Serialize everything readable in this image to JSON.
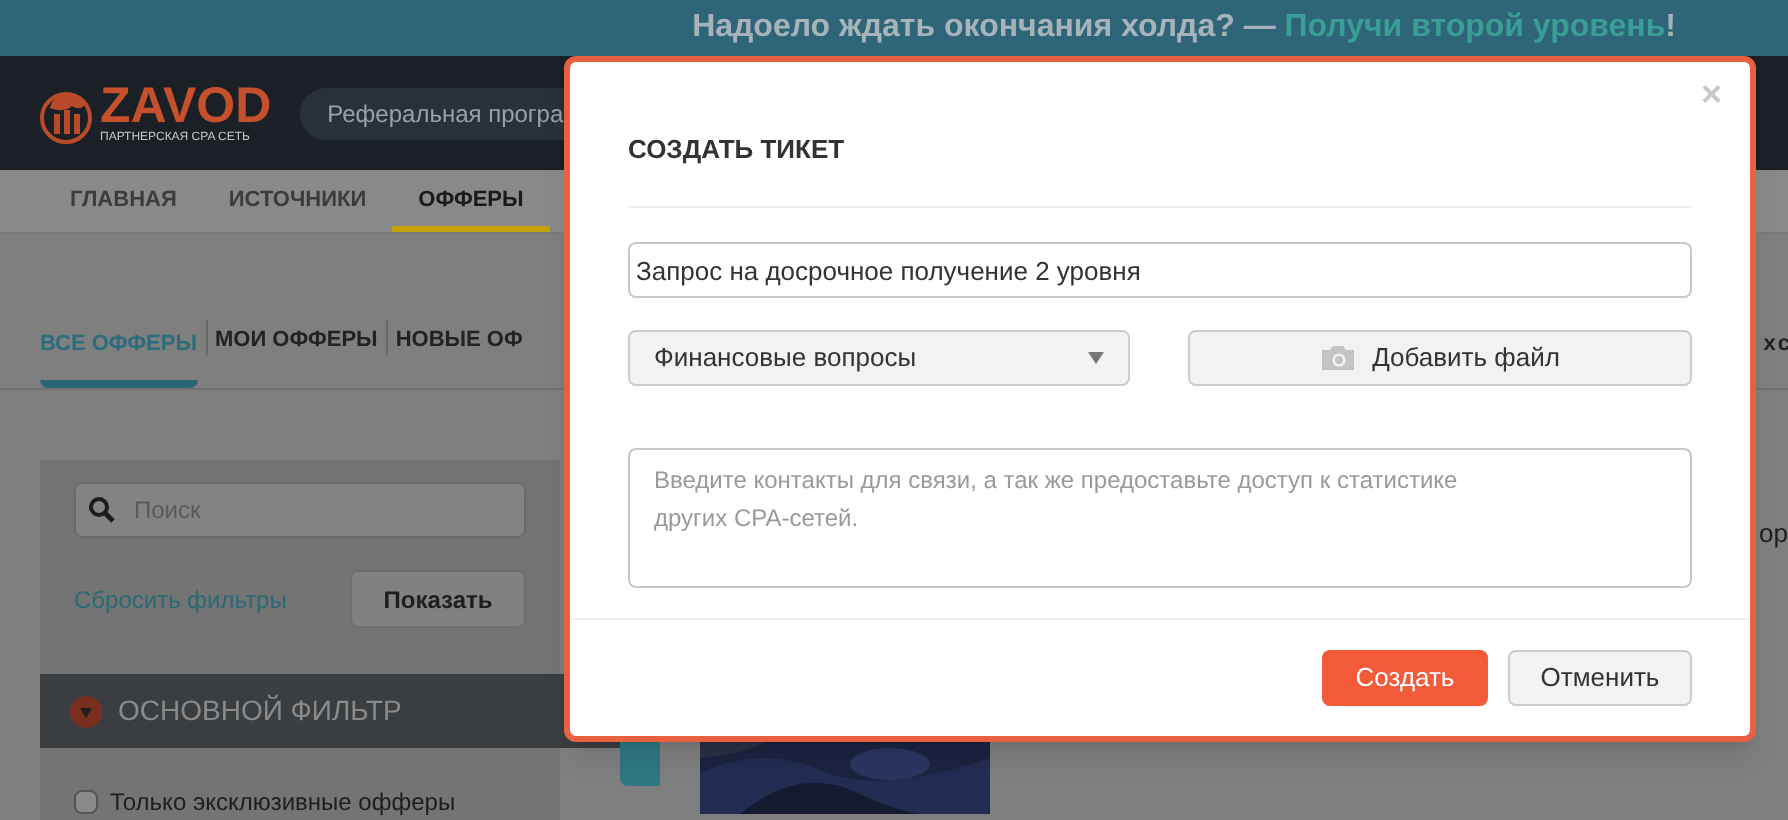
{
  "banner": {
    "text": "Надоело ждать окончания холда? — ",
    "link": "Получи второй уровень",
    "end": "!"
  },
  "header": {
    "logo": "ZAVOD",
    "tagline": "ПАРТНЕРСКАЯ CPA СЕТЬ",
    "referral": "Реферальная програ"
  },
  "nav": [
    {
      "label": "ГЛАВНАЯ",
      "selected": false
    },
    {
      "label": "ИСТОЧНИКИ",
      "selected": false
    },
    {
      "label": "ОФФЕРЫ",
      "selected": true
    }
  ],
  "offer_tabs": [
    {
      "label": "ВСЕ ОФФЕРЫ",
      "selected": true
    },
    {
      "label": "МОИ ОФФЕРЫ",
      "selected": false
    },
    {
      "label": "НОВЫЕ ОФ",
      "selected": false
    }
  ],
  "offer_tabs_overflow": "х с",
  "filter": {
    "search_placeholder": "Поиск",
    "reset": "Сбросить фильтры",
    "show": "Показать",
    "section": {
      "title": "ОСНОВНОЙ ФИЛЬТР",
      "expanded": true
    },
    "options": [
      {
        "label": "Только эксклюзивные офферы",
        "checked": false
      }
    ]
  },
  "side_text": "ор",
  "modal": {
    "title": "СОЗДАТЬ ТИКЕТ",
    "close": "×",
    "subject": "Запрос на досрочное получение 2 уровня",
    "category": "Финансовые вопросы",
    "attach": "Добавить файл",
    "message_placeholder": "Введите контакты для связи, а так же предоставьте доступ к статистике других CPA-сетей.",
    "buttons": [
      {
        "label": "Создать",
        "kind": "primary"
      },
      {
        "label": "Отменить",
        "kind": "secondary"
      }
    ]
  }
}
